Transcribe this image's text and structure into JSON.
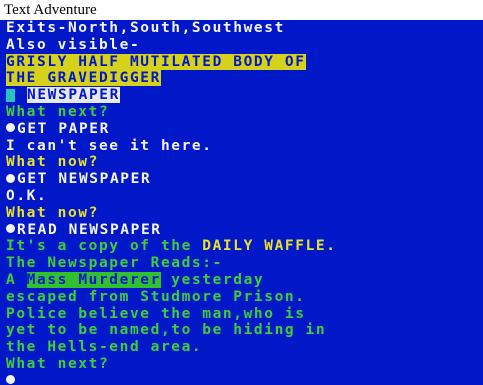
{
  "window": {
    "title": "Text Adventure"
  },
  "terminal": {
    "line01": "Exits-North,South,Southwest",
    "line02": "Also visible-",
    "line03": "GRISLY HALF MUTILATED BODY OF",
    "line04": "THE GRAVEDIGGER",
    "line05": "NEWSPAPER",
    "line06": "What next?",
    "line07": "GET PAPER",
    "line08": "I can't see it here.",
    "line09": "What now?",
    "line10": "GET NEWSPAPER",
    "line11": "O.K.",
    "line12": "What now?",
    "line13": "READ NEWSPAPER",
    "line14_a": "It's a copy of the ",
    "line14_b": "DAILY WAFFLE.",
    "line15": "The Newspaper Reads:-",
    "line16_a": "A ",
    "line16_b": "Mass Murderer",
    "line16_c": " yesterday",
    "line17": "escaped from Studmore Prison.",
    "line18": "Police believe the man,who is",
    "line19": "yet to be named,to be hiding in",
    "line20": "the Hells-end area.",
    "line21": "What next?"
  },
  "colors": {
    "screen_background": "#0018c8",
    "room_text": "#f4f4f4",
    "prompt_text": "#3ccf3c",
    "response_text": "#e8e22a",
    "item_highlight": "#d6d21c"
  }
}
